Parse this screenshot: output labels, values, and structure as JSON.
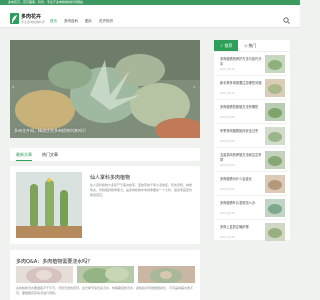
{
  "topbar": {
    "text": "多肉花卉，花卉图库，科普，专注于多肉植物的科普网站"
  },
  "brand": {
    "name": "多肉花卉",
    "tagline": "专注多肉植物科普"
  },
  "nav": {
    "items": [
      "首页",
      "多肉百科",
      "图片",
      "花卉知识"
    ]
  },
  "hero": {
    "caption": "多肉花卉网，精选优质多肉植物科普知识"
  },
  "tabs": {
    "items": [
      "最新文章",
      "热门文章"
    ]
  },
  "article1": {
    "title": "仙人掌科多肉植物",
    "text": "仙人掌科植物大多原产于美洲热带、亚热带的干旱沙漠地区，形态奇特，种类繁多，有较强的耐旱能力，是多肉植物中非常重要的一个大科，适合家庭室内栽培观赏。"
  },
  "article2": {
    "title": "多肉Q&A：多肉植物需要浇水吗？",
    "text": "多肉植物浇水要遵循不干不浇、浇则浇透的原则，生长季节适当多浇水，休眠期控制浇水，避免积水导致根部腐烂，不同品种需水量不同，要根据实际情况进行调整。"
  },
  "sidebar": {
    "tabs": [
      "推荐",
      "热门"
    ],
    "items": [
      {
        "title": "多肉植物的养护方法与技巧分享",
        "date": "2021-05-12"
      },
      {
        "title": "新手养多肉需要注意哪些问题",
        "date": "2021-05-10"
      },
      {
        "title": "多肉植物的繁殖方法有哪些",
        "date": "2021-05-08"
      },
      {
        "title": "冬季多肉植物如何安全过冬",
        "date": "2021-05-06"
      },
      {
        "title": "玉露多肉的养殖方法和注意事项",
        "date": "2021-05-04"
      },
      {
        "title": "多肉植物为什么会徒长",
        "date": "2021-05-02"
      },
      {
        "title": "多肉植物叶片发软怎么办",
        "date": "2021-04-30"
      },
      {
        "title": "多肉上盆的正确步骤",
        "date": "2021-04-28"
      }
    ]
  },
  "colors": {
    "accent": "#2f9e5a",
    "topbar": "#3d9b62"
  }
}
